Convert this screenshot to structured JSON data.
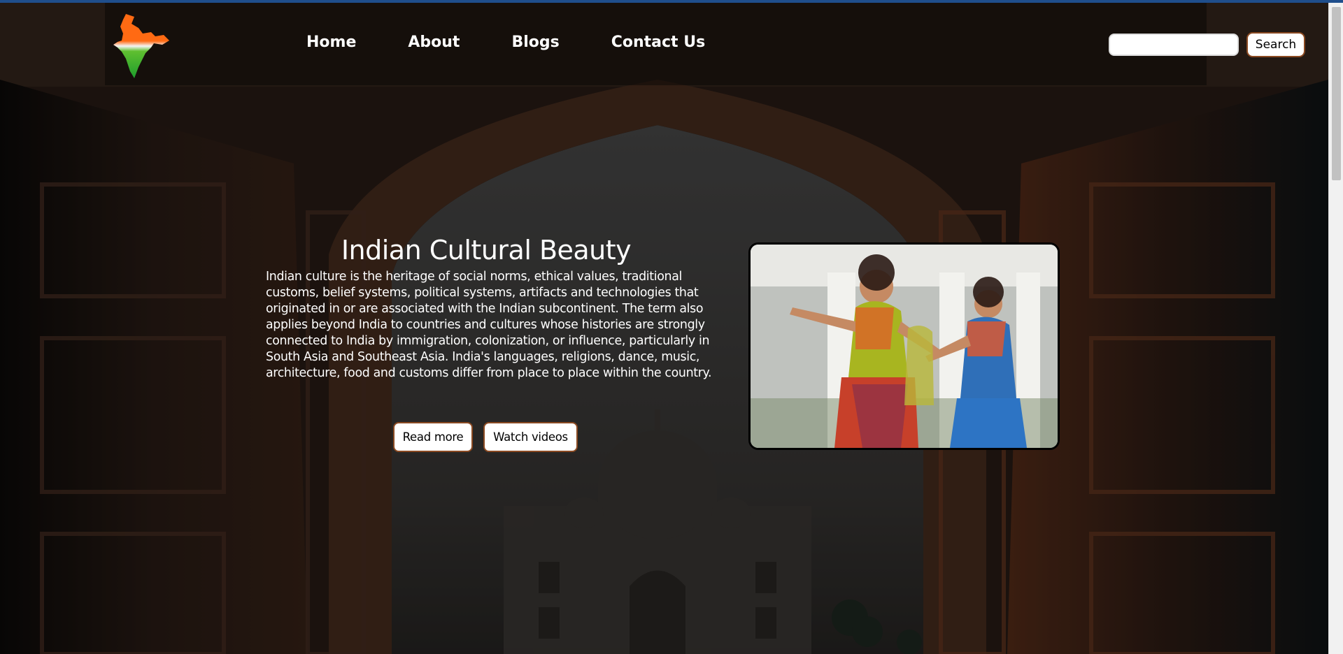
{
  "nav": {
    "logo_icon": "india-map-logo-icon",
    "links": [
      "Home",
      "About",
      "Blogs",
      "Contact Us"
    ],
    "search": {
      "value": "",
      "placeholder": "",
      "button_label": "Search"
    }
  },
  "hero": {
    "title": "Indian Cultural Beauty",
    "description": "Indian culture is the heritage of social norms, ethical values, traditional customs, belief systems, political systems, artifacts and technologies that originated in or are associated with the Indian subcontinent. The term also applies beyond India to countries and cultures whose histories are strongly connected to India by immigration, colonization, or influence, particularly in South Asia and Southeast Asia. India's languages, religions, dance, music, architecture, food and customs differ from place to place within the country.",
    "buttons": {
      "read_more": "Read more",
      "watch_videos": "Watch videos"
    },
    "image_icon": "dancers-photo"
  },
  "colors": {
    "button_border": "#8b4a22",
    "accent_blue": "#1f4e8c",
    "flag_saffron": "#ff6a13",
    "flag_green": "#1e9e2c"
  }
}
